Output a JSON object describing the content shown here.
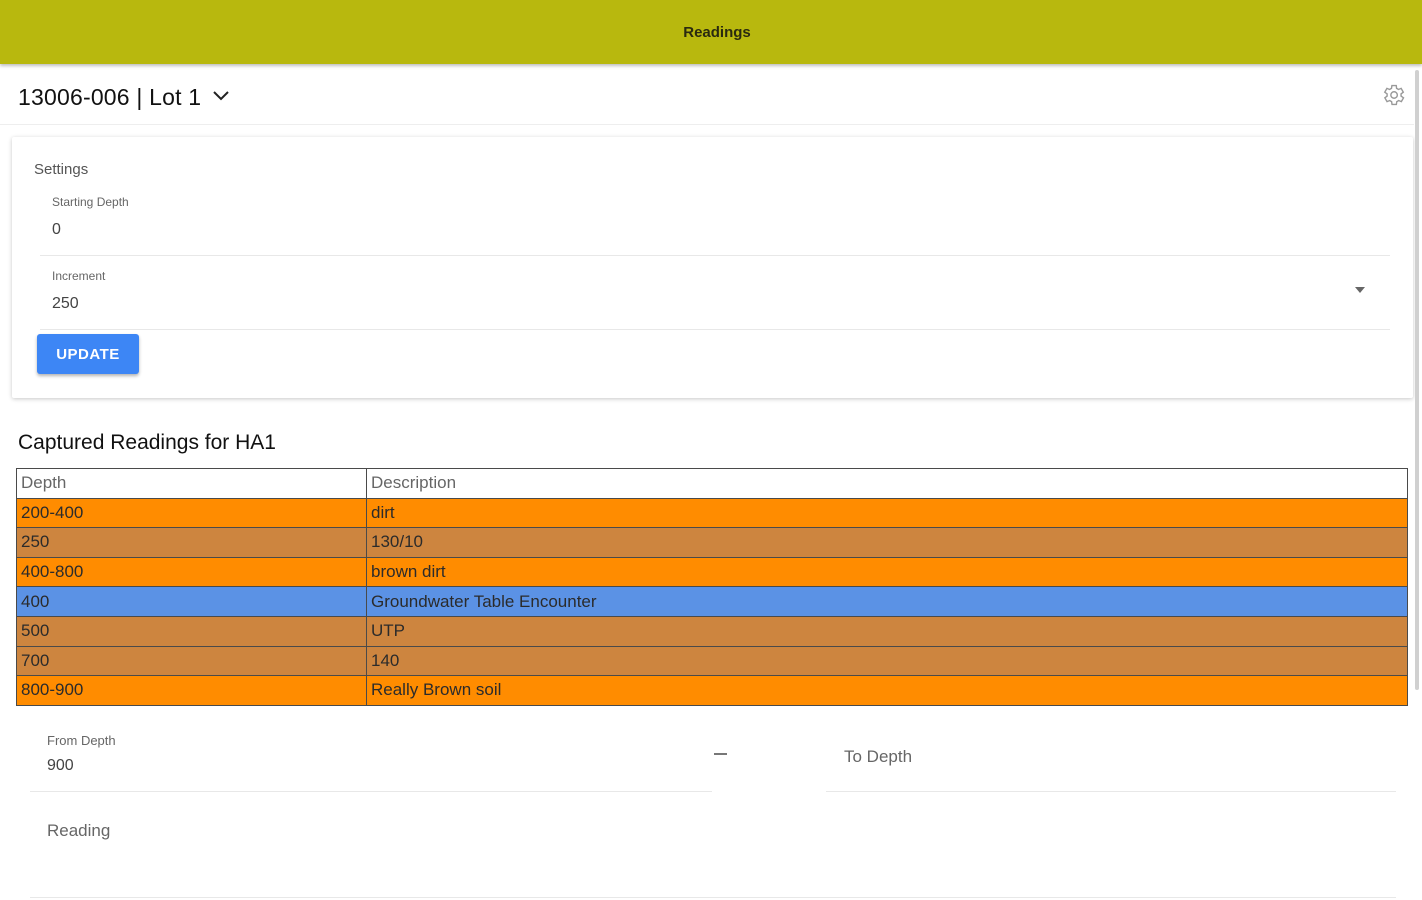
{
  "app_bar": {
    "title": "Readings",
    "color": "#b8b80e"
  },
  "header": {
    "project_title": "13006-006 | Lot 1",
    "chevron_icon": "chevron-down-icon",
    "settings_icon": "gear-icon"
  },
  "settings": {
    "title": "Settings",
    "starting_depth": {
      "label": "Starting Depth",
      "value": "0"
    },
    "increment": {
      "label": "Increment",
      "value": "250"
    },
    "update_label": "UPDATE",
    "button_color": "#3d86f5"
  },
  "readings": {
    "title": "Captured Readings for HA1",
    "columns": [
      "Depth",
      "Description"
    ],
    "row_colors": {
      "range": "#ff8c00",
      "point": "#cd853f",
      "groundwater": "#5b92e5"
    },
    "rows": [
      {
        "depth": "200-400",
        "description": "dirt",
        "kind": "range"
      },
      {
        "depth": "250",
        "description": "130/10",
        "kind": "point"
      },
      {
        "depth": "400-800",
        "description": "brown dirt",
        "kind": "range"
      },
      {
        "depth": "400",
        "description": "Groundwater Table Encounter",
        "kind": "groundwater"
      },
      {
        "depth": "500",
        "description": "UTP",
        "kind": "point"
      },
      {
        "depth": "700",
        "description": "140",
        "kind": "point"
      },
      {
        "depth": "800-900",
        "description": "Really Brown soil",
        "kind": "range"
      }
    ]
  },
  "form": {
    "from_depth": {
      "label": "From Depth",
      "value": "900"
    },
    "to_depth": {
      "placeholder": "To Depth"
    },
    "reading": {
      "placeholder": "Reading"
    }
  }
}
